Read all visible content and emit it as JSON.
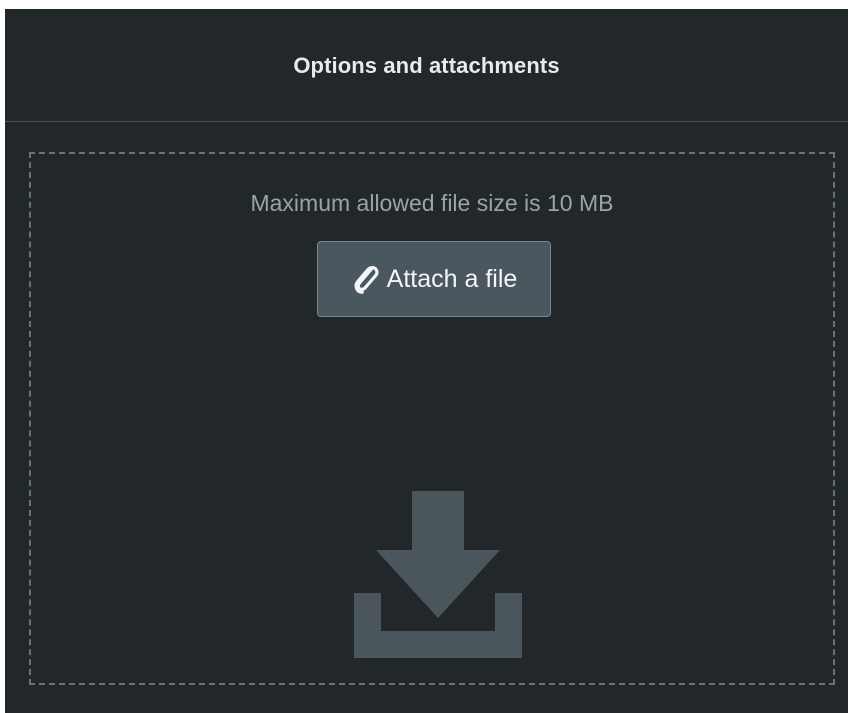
{
  "panel": {
    "title": "Options and attachments"
  },
  "dropzone": {
    "size_hint": "Maximum allowed file size is 10 MB",
    "attach_button_label": "Attach a file",
    "attach_button_icon": "paperclip-icon",
    "drop_icon": "download-icon"
  },
  "colors": {
    "panel_background": "#22272a",
    "button_background": "#4a575e",
    "dashed_border": "#66737a",
    "drop_icon": "#4b565c"
  }
}
